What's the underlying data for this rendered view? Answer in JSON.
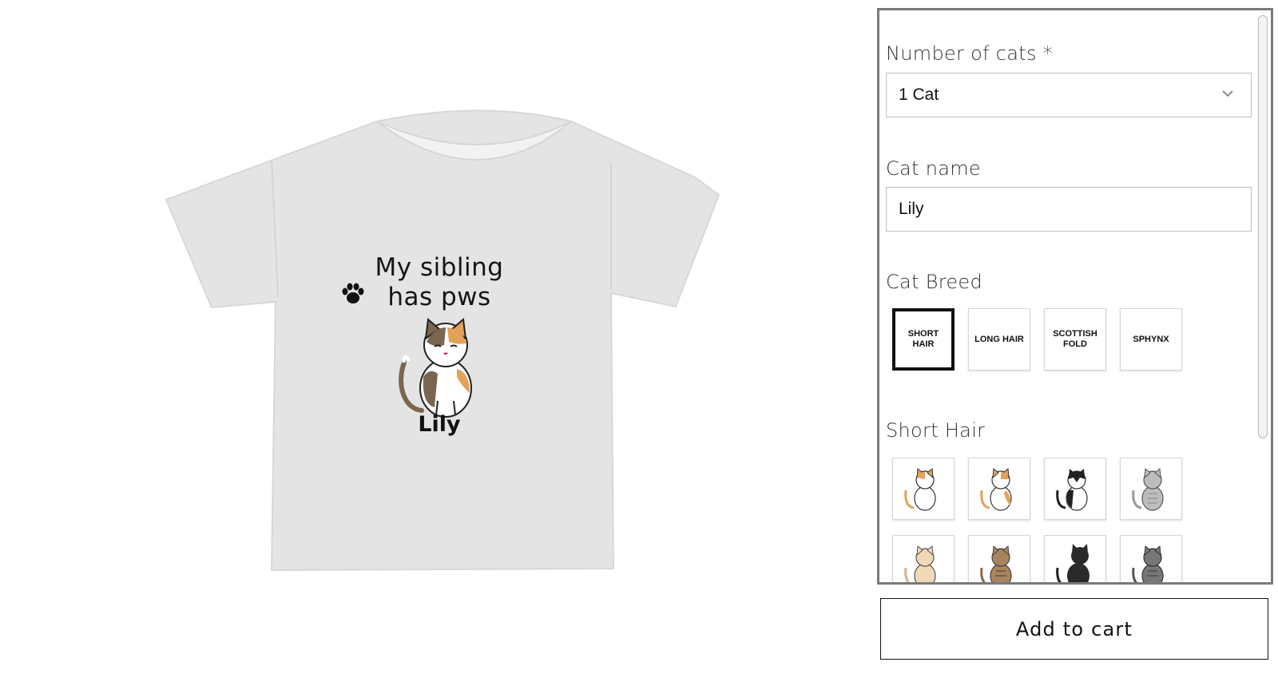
{
  "preview": {
    "shirt_line1": "My sibling",
    "shirt_line2_pre": "has p",
    "shirt_line2_post": "ws",
    "shirt_name": "Lily",
    "shirt_color": "#e4e4e4"
  },
  "options": {
    "num_cats_label": "Number of cats *",
    "num_cats_value": "1 Cat",
    "cat_name_label": "Cat name",
    "cat_name_value": "Lily",
    "breed_label": "Cat Breed",
    "breeds": [
      "SHORT HAIR",
      "LONG HAIR",
      "SCOTTISH FOLD",
      "SPHYNX"
    ],
    "selected_breed": "SHORT HAIR",
    "short_hair_label": "Short Hair"
  },
  "cart": {
    "label": "Add to cart"
  }
}
